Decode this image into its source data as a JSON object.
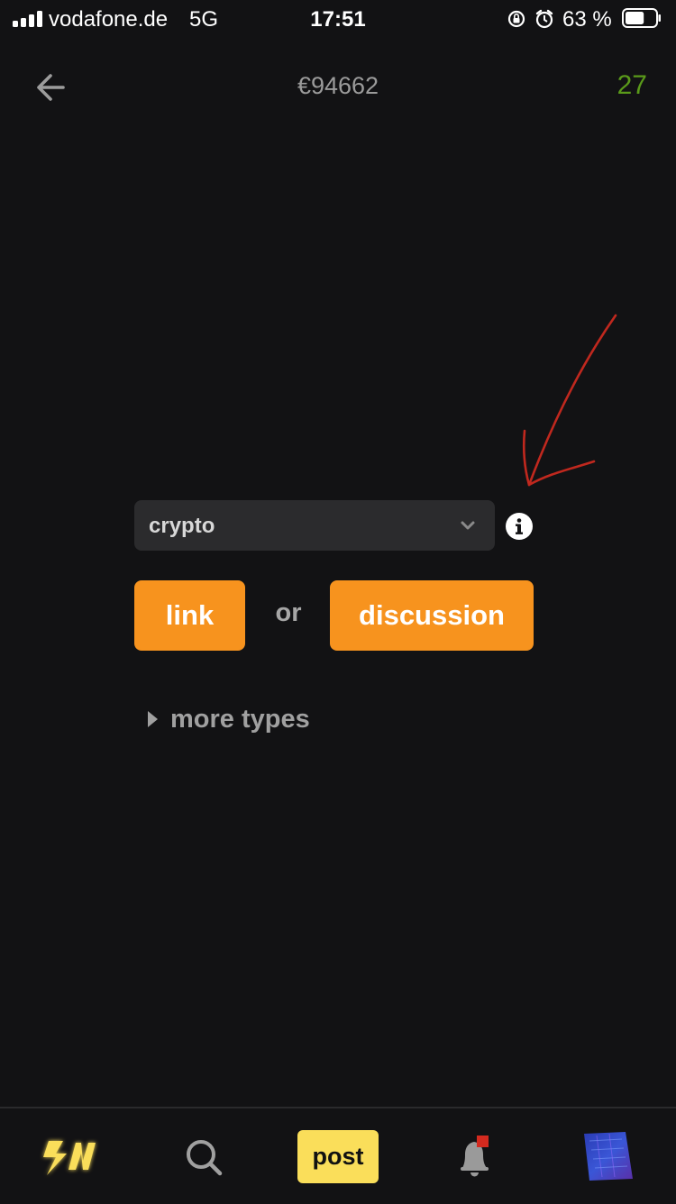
{
  "status_bar": {
    "carrier": "vodafone.de",
    "network": "5G",
    "time": "17:51",
    "battery_percent": "63 %",
    "battery_level": 0.63
  },
  "header": {
    "back_icon": "arrow-left-icon",
    "balance": "€94662",
    "sats": "27",
    "sats_color": "#5a9a1a"
  },
  "form": {
    "territory_select": {
      "value": "crypto",
      "chevron_icon": "chevron-down-icon"
    },
    "info_icon": "info-icon",
    "link_button": "link",
    "or_label": "or",
    "discussion_button": "discussion",
    "more_types": "more types",
    "accent_color": "#f7931e"
  },
  "annotation": {
    "arrow_color": "#c0281e"
  },
  "bottom_nav": {
    "logo_text": "SN",
    "logo_color": "#fade5a",
    "search_icon": "search-icon",
    "post_label": "post",
    "bell_icon": "bell-icon",
    "notification_badge_color": "#d42a1f",
    "avatar_icon": "avatar-icon"
  }
}
